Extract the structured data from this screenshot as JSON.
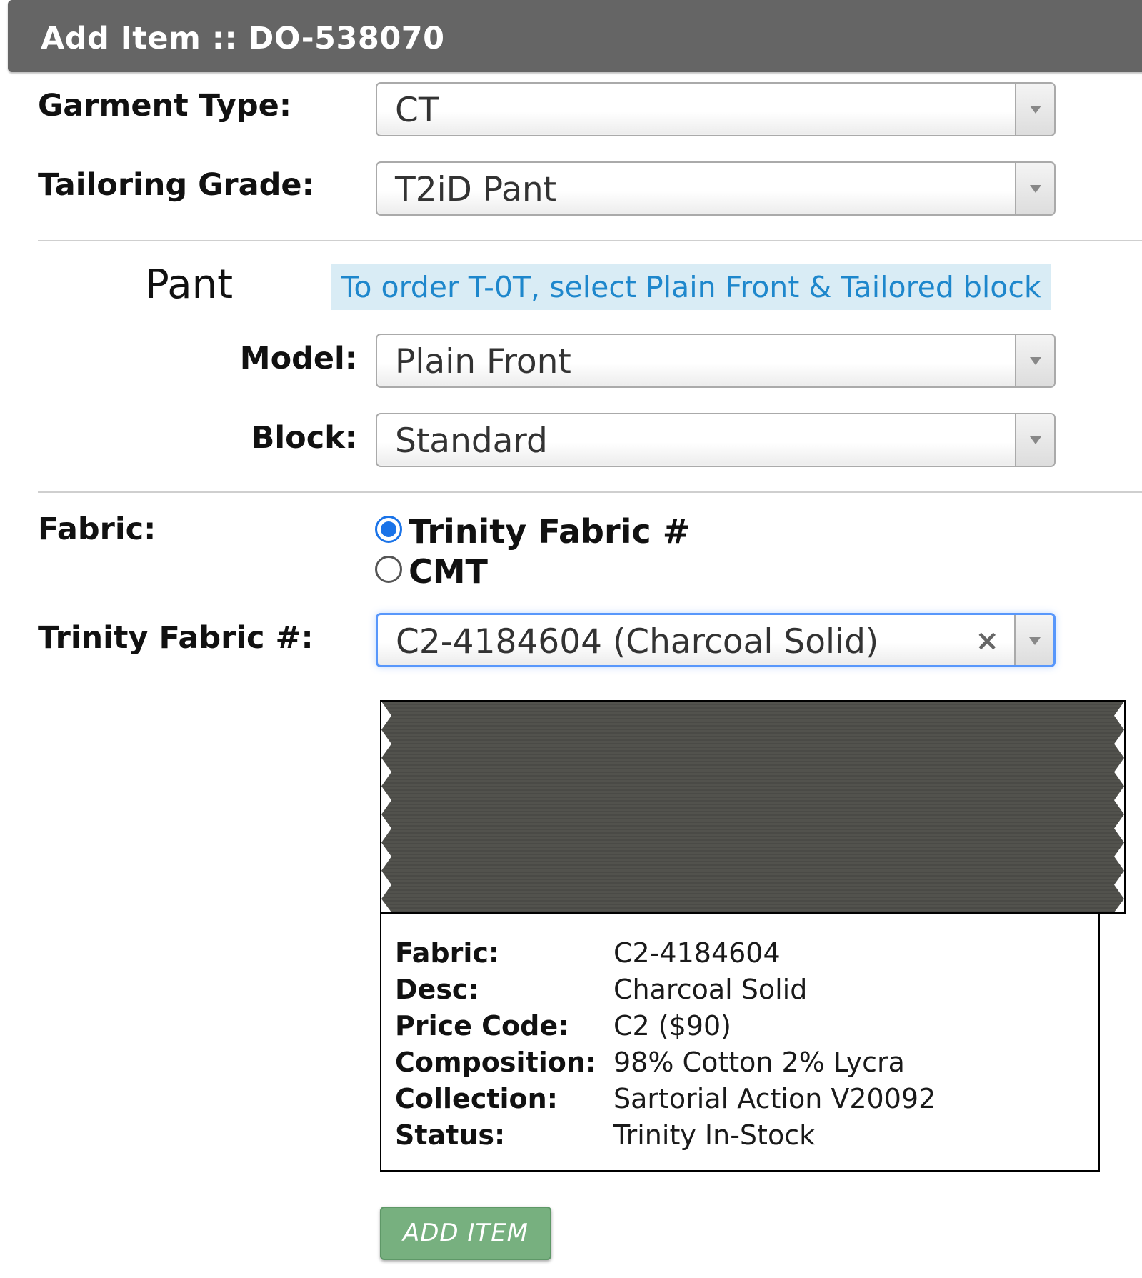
{
  "header": {
    "title": "Add Item :: DO-538070"
  },
  "garment_type": {
    "label": "Garment Type:",
    "value": "CT"
  },
  "tailoring_grade": {
    "label": "Tailoring Grade:",
    "value": "T2iD Pant"
  },
  "pant_section": {
    "label": "Pant",
    "hint": "To order T-0T, select Plain Front & Tailored block",
    "model": {
      "label": "Model:",
      "value": "Plain Front"
    },
    "block": {
      "label": "Block:",
      "value": "Standard"
    }
  },
  "fabric": {
    "label": "Fabric:",
    "options": [
      {
        "label": "Trinity Fabric #",
        "checked": true
      },
      {
        "label": "CMT",
        "checked": false
      }
    ]
  },
  "trinity_fabric": {
    "label": "Trinity Fabric #:",
    "value": "C2-4184604 (Charcoal Solid)",
    "clear_glyph": "×"
  },
  "swatch": {
    "color": "#4d4d49",
    "accent_color": "#ffffff"
  },
  "fabric_info": {
    "rows": [
      {
        "key": "Fabric:",
        "value": "C2-4184604"
      },
      {
        "key": "Desc:",
        "value": "Charcoal Solid"
      },
      {
        "key": "Price Code:",
        "value": "C2 ($90)"
      },
      {
        "key": "Composition:",
        "value": "98% Cotton 2% Lycra"
      },
      {
        "key": "Collection:",
        "value": "Sartorial Action V20092"
      },
      {
        "key": "Status:",
        "value": "Trinity In-Stock"
      }
    ]
  },
  "actions": {
    "add_item_label": "ADD ITEM",
    "add_item_color": "#77b07f"
  },
  "icons": {
    "dropdown": "chevron-down-icon",
    "clear": "close-icon",
    "radio": "radio-icon"
  }
}
